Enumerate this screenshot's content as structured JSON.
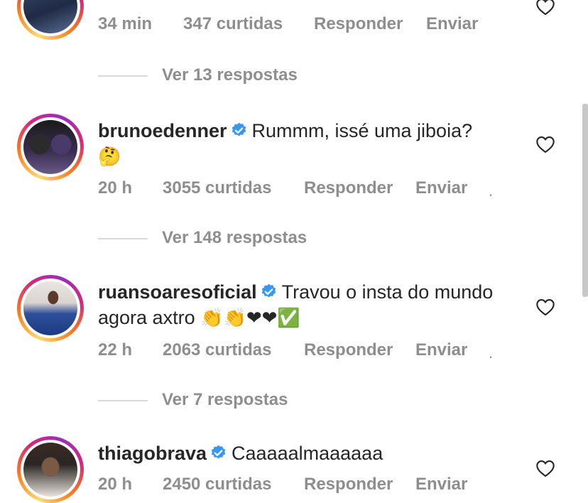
{
  "comments": [
    {
      "username": "",
      "text": "",
      "time": "34 min",
      "likes": "347 curtidas",
      "reply": "Responder",
      "send": "Enviar",
      "view_replies": "Ver 13 respostas"
    },
    {
      "username": "brunoedenner",
      "text": "Rummm, issé uma jiboia?",
      "emoji": "🤔",
      "time": "20 h",
      "likes": "3055 curtidas",
      "reply": "Responder",
      "send": "Enviar",
      "view_replies": "Ver 148 respostas"
    },
    {
      "username": "ruansoaresoficial",
      "text": "Travou o insta do mundo agora axtro",
      "emoji": "👏👏❤❤✅",
      "time": "22 h",
      "likes": "2063 curtidas",
      "reply": "Responder",
      "send": "Enviar",
      "view_replies": "Ver 7 respostas"
    },
    {
      "username": "thiagobrava",
      "text": "Caaaaalmaaaaaa",
      "time": "20 h",
      "likes": "2450 curtidas",
      "reply": "Responder",
      "send": "Enviar"
    }
  ],
  "icons": {
    "verified": "verified-badge-icon",
    "like": "heart-icon"
  },
  "colors": {
    "verified": "#3897f0",
    "muted": "#8e8e8e",
    "text": "#262626"
  }
}
